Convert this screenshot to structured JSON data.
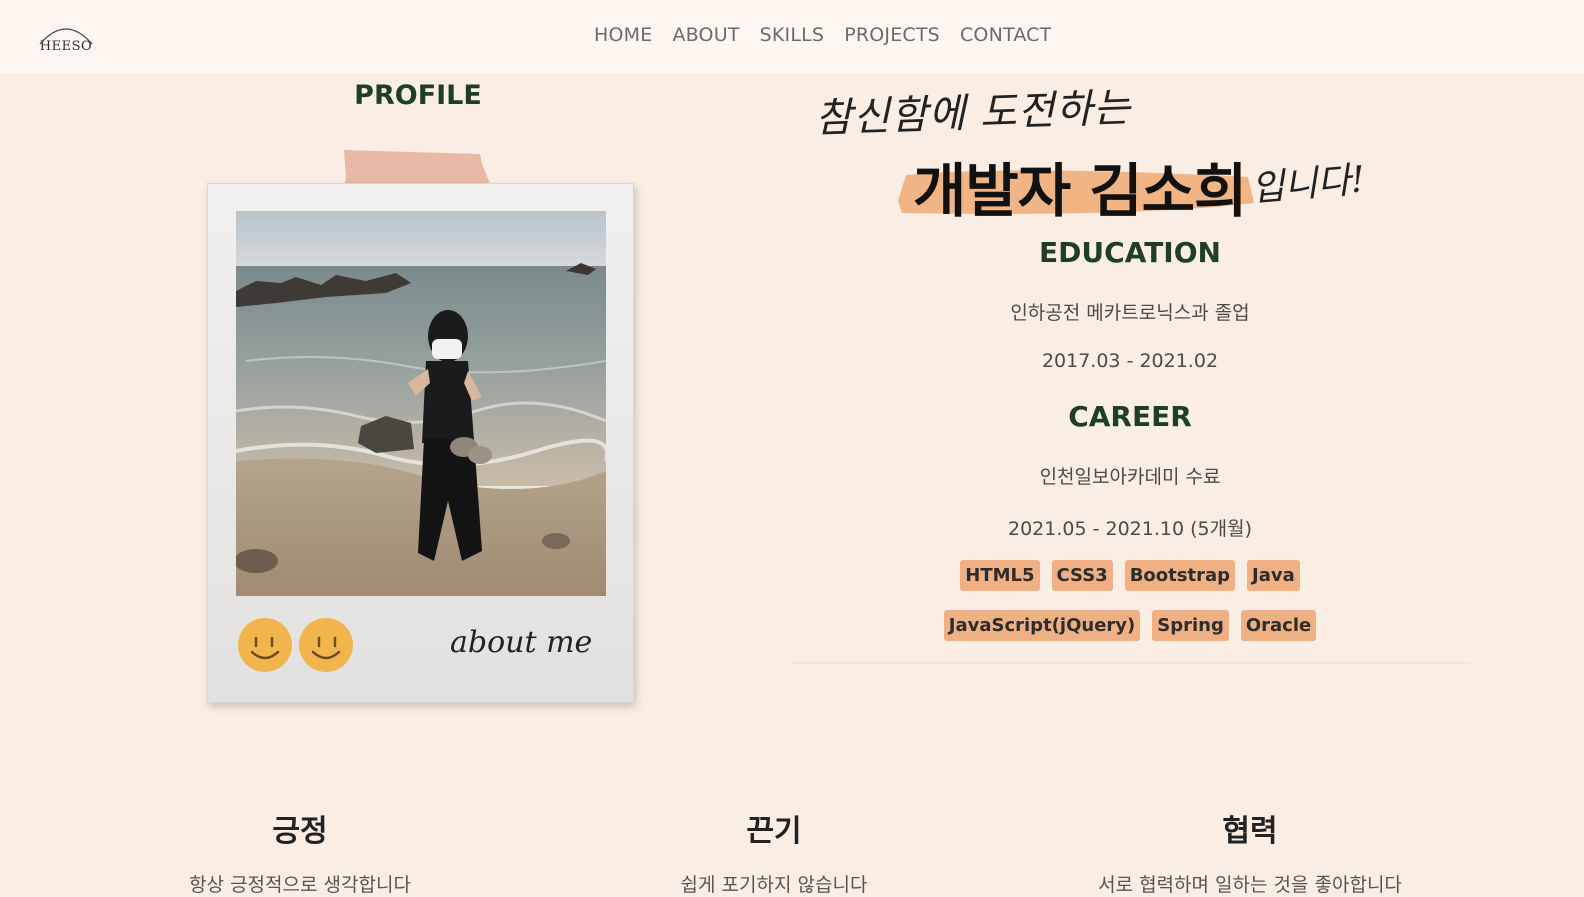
{
  "header": {
    "logo_text": "HEESO",
    "nav": [
      {
        "label": "HOME"
      },
      {
        "label": "ABOUT"
      },
      {
        "label": "SKILLS"
      },
      {
        "label": "PROJECTS"
      },
      {
        "label": "CONTACT"
      }
    ]
  },
  "profile": {
    "title": "PROFILE",
    "caption": "about me",
    "smileys": 2
  },
  "intro": {
    "line1": "참신함에 도전하는",
    "line2": "개발자 김소희",
    "line3": "입니다!"
  },
  "education": {
    "title": "EDUCATION",
    "school": "인하공전 메카트로닉스과 졸업",
    "period": "2017.03 - 2021.02"
  },
  "career": {
    "title": "CAREER",
    "academy": "인천일보아카데미 수료",
    "period": "2021.05 - 2021.10 (5개월)"
  },
  "skills": {
    "row1": [
      "HTML5",
      "CSS3",
      "Bootstrap",
      "Java"
    ],
    "row2": [
      "JavaScript(jQuery)",
      "Spring",
      "Oracle"
    ]
  },
  "values": [
    {
      "title": "긍정",
      "desc": "항상 긍정적으로 생각합니다"
    },
    {
      "title": "끈기",
      "desc": "쉽게 포기하지 않습니다"
    },
    {
      "title": "협력",
      "desc": "서로 협력하며 일하는 것을 좋아합니다"
    }
  ],
  "colors": {
    "background": "#f9ede4",
    "header": "#fdf6f1",
    "heading_green": "#1e3f21",
    "tag_orange": "#efb083"
  }
}
